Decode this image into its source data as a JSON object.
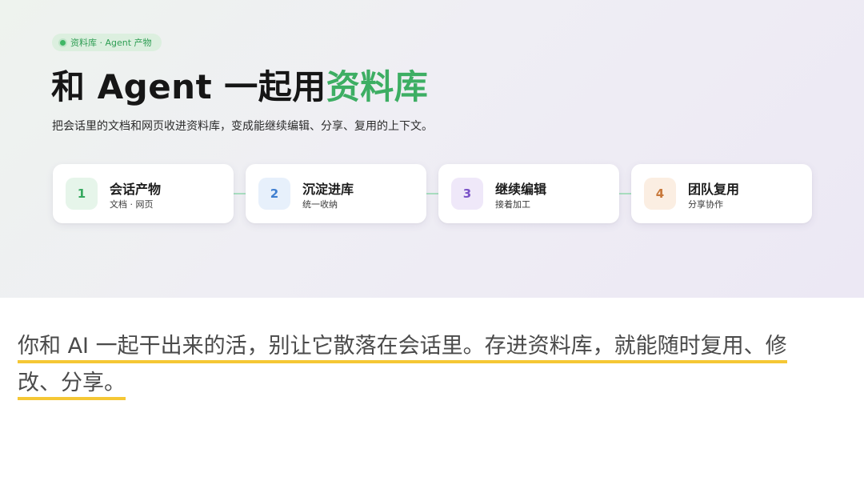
{
  "hero": {
    "pill_label": "资料库 · Agent 产物",
    "title_main": "和 Agent 一起用",
    "title_accent": "资料库",
    "subtitle": "把会话里的文档和网页收进资料库，变成能继续编辑、分享、复用的上下文。",
    "accent_color": "#3dae63"
  },
  "steps": [
    {
      "num": "1",
      "title": "会话产物",
      "sub": "文档 · 网页",
      "color": "#35a85e",
      "bg": "#e6f5ea"
    },
    {
      "num": "2",
      "title": "沉淀进库",
      "sub": "统一收纳",
      "color": "#3f7fd0",
      "bg": "#e7f0fb"
    },
    {
      "num": "3",
      "title": "继续编辑",
      "sub": "接着加工",
      "color": "#7a52c7",
      "bg": "#efe8f9"
    },
    {
      "num": "4",
      "title": "团队复用",
      "sub": "分享协作",
      "color": "#c8783a",
      "bg": "#fbeee2"
    }
  ],
  "body": {
    "line1": "你和 AI 一起干出来的活，别让它散落在会话里。存进资料库，就能随时复用、修",
    "line2": "改、分享。",
    "underline_color": "#f5c735"
  }
}
